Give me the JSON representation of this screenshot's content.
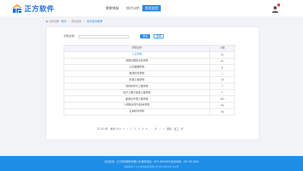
{
  "header": {
    "logo_text": "正方软件",
    "nav": [
      "健康填报",
      "统计分析",
      "签名监控"
    ],
    "active_nav_index": 2,
    "badge_color": "#e33333",
    "accent": "#2b8de8"
  },
  "breadcrumb": {
    "home": "当前位置",
    "items": [
      "首页",
      "签名监控",
      "签名监控管理"
    ]
  },
  "search": {
    "label": "学院名称",
    "placeholder": "",
    "query_label": "查询",
    "reset_label": "重置"
  },
  "table": {
    "headers": [
      "学院名称",
      "人数"
    ],
    "rows": [
      [
        "人文学院",
        "21"
      ],
      [
        "传媒与国际文化学院",
        "21"
      ],
      [
        "公共管理学院",
        "8"
      ],
      [
        "数学科学学院",
        "7"
      ],
      [
        "机械工程学院",
        "13"
      ],
      [
        "材料科学与工程学院",
        "7"
      ],
      [
        "电子工程与信息工程学院",
        "7"
      ],
      [
        "能源与环境工程学院",
        "121"
      ],
      [
        "计算机科学与技术学院",
        "34"
      ],
      [
        "生命科学学院",
        "34"
      ]
    ]
  },
  "pager": {
    "total": "共 101 条",
    "page_size": "每页 10 ▾",
    "first": "«",
    "prev": "‹",
    "pages": [
      "1",
      "2",
      "3",
      "4",
      "5",
      "...",
      "11"
    ],
    "current_page": "1",
    "next": "›",
    "last": "»",
    "goto_label": "跳至",
    "goto_value": "1",
    "goto_unit": "页"
  },
  "footer": {
    "line1": "技术支持：正方软件股份有限公司     服务电话：0571-89902828     技术热线：400-700-2828",
    "line2": "版权所有 © 正方软件股份有限公司 浙ICP备05007209号"
  }
}
